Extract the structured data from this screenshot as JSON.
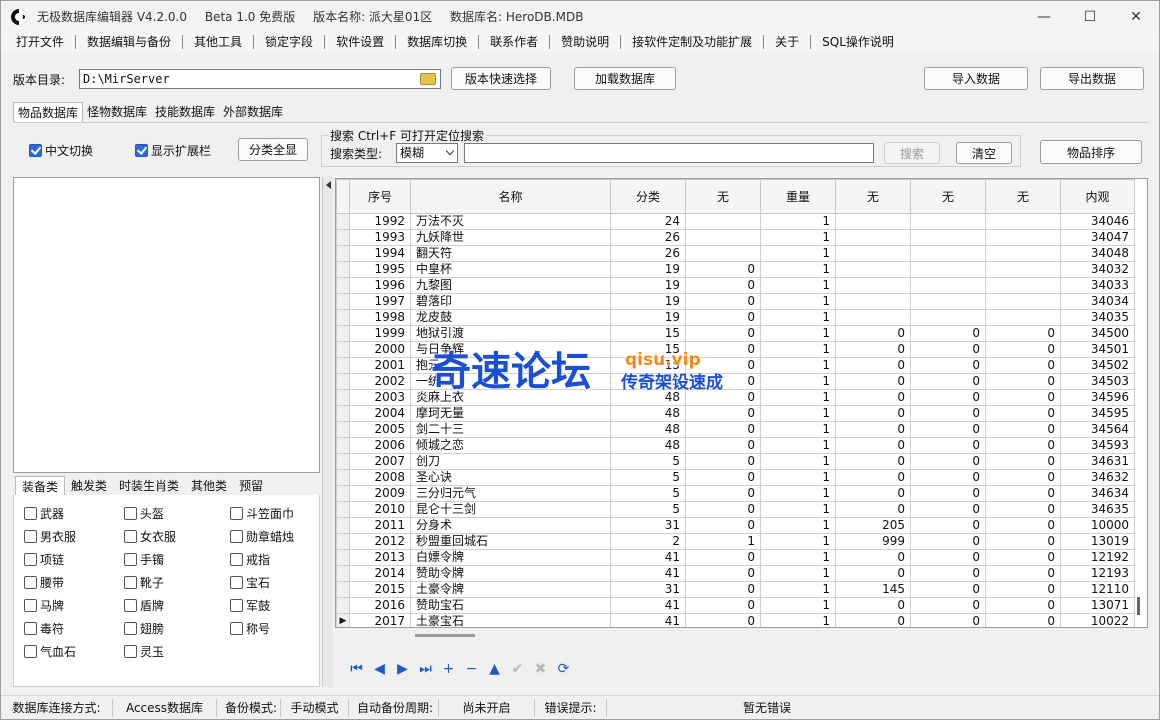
{
  "titlebar": {
    "app_name": "无极数据库编辑器 V4.2.0.0",
    "edition": "Beta 1.0 免费版",
    "version_name": "版本名称: 派大星01区",
    "db_name": "数据库名: HeroDB.MDB",
    "minimize": "—",
    "maximize": "☐",
    "close": "✕"
  },
  "menu": [
    "打开文件",
    "数据编辑与备份",
    "其他工具",
    "锁定字段",
    "软件设置",
    "数据库切换",
    "联系作者",
    "赞助说明",
    "接软件定制及功能扩展",
    "关于",
    "SQL操作说明"
  ],
  "toolbar": {
    "dir_label": "版本目录:",
    "dir_value": "D:\\MirServer",
    "quick_select": "版本快速选择",
    "load_db": "加载数据库",
    "import": "导入数据",
    "export": "导出数据"
  },
  "tabs": [
    "物品数据库",
    "怪物数据库",
    "技能数据库",
    "外部数据库"
  ],
  "options": {
    "chinese_switch": "中文切换",
    "show_ext": "显示扩展栏",
    "expand_all": "分类全显",
    "search_legend": "搜索  Ctrl+F 可打开定位搜索",
    "search_type_label": "搜索类型:",
    "search_type_value": "模糊",
    "search_btn": "搜索",
    "clear_btn": "清空",
    "sort_btn": "物品排序"
  },
  "category_tabs": [
    "装备类",
    "触发类",
    "时装生肖类",
    "其他类",
    "预留"
  ],
  "categories": [
    "武器",
    "头盔",
    "斗笠面巾",
    "男衣服",
    "女衣服",
    "勋章蜡烛",
    "项链",
    "手镯",
    "戒指",
    "腰带",
    "靴子",
    "宝石",
    "马牌",
    "盾牌",
    "军鼓",
    "毒符",
    "翅膀",
    "称号",
    "气血石",
    "灵玉"
  ],
  "grid": {
    "columns": [
      "序号",
      "名称",
      "分类",
      "无",
      "重量",
      "无",
      "无",
      "无",
      "内观"
    ],
    "rows": [
      [
        "1992",
        "万法不灭",
        "24",
        "",
        "1",
        "",
        "",
        "",
        "34046"
      ],
      [
        "1993",
        "九妖降世",
        "26",
        "",
        "1",
        "",
        "",
        "",
        "34047"
      ],
      [
        "1994",
        "翻天符",
        "26",
        "",
        "1",
        "",
        "",
        "",
        "34048"
      ],
      [
        "1995",
        "中皇杯",
        "19",
        "0",
        "1",
        "",
        "",
        "",
        "34032"
      ],
      [
        "1996",
        "九黎图",
        "19",
        "0",
        "1",
        "",
        "",
        "",
        "34033"
      ],
      [
        "1997",
        "碧落印",
        "19",
        "0",
        "1",
        "",
        "",
        "",
        "34034"
      ],
      [
        "1998",
        "龙皮鼓",
        "19",
        "0",
        "1",
        "",
        "",
        "",
        "34035"
      ],
      [
        "1999",
        "地狱引渡",
        "15",
        "0",
        "1",
        "0",
        "0",
        "0",
        "34500"
      ],
      [
        "2000",
        "与日争辉",
        "15",
        "0",
        "1",
        "0",
        "0",
        "0",
        "34501"
      ],
      [
        "2001",
        "抱元",
        "15",
        "0",
        "1",
        "0",
        "0",
        "0",
        "34502"
      ],
      [
        "2002",
        "一统",
        "15",
        "0",
        "1",
        "0",
        "0",
        "0",
        "34503"
      ],
      [
        "2003",
        "炎麻上衣",
        "48",
        "0",
        "1",
        "0",
        "0",
        "0",
        "34596"
      ],
      [
        "2004",
        "摩珂无量",
        "48",
        "0",
        "1",
        "0",
        "0",
        "0",
        "34595"
      ],
      [
        "2005",
        "剑二十三",
        "48",
        "0",
        "1",
        "0",
        "0",
        "0",
        "34564"
      ],
      [
        "2006",
        "倾城之恋",
        "48",
        "0",
        "1",
        "0",
        "0",
        "0",
        "34593"
      ],
      [
        "2007",
        "创刀",
        "5",
        "0",
        "1",
        "0",
        "0",
        "0",
        "34631"
      ],
      [
        "2008",
        "圣心诀",
        "5",
        "0",
        "1",
        "0",
        "0",
        "0",
        "34632"
      ],
      [
        "2009",
        "三分归元气",
        "5",
        "0",
        "1",
        "0",
        "0",
        "0",
        "34634"
      ],
      [
        "2010",
        "昆仑十三剑",
        "5",
        "0",
        "1",
        "0",
        "0",
        "0",
        "34635"
      ],
      [
        "2011",
        "分身术",
        "31",
        "0",
        "1",
        "205",
        "0",
        "0",
        "10000"
      ],
      [
        "2012",
        "秒盟重回城石",
        "2",
        "1",
        "1",
        "999",
        "0",
        "0",
        "13019"
      ],
      [
        "2013",
        "白嫖令牌",
        "41",
        "0",
        "1",
        "0",
        "0",
        "0",
        "12192"
      ],
      [
        "2014",
        "赞助令牌",
        "41",
        "0",
        "1",
        "0",
        "0",
        "0",
        "12193"
      ],
      [
        "2015",
        "土豪令牌",
        "31",
        "0",
        "1",
        "145",
        "0",
        "0",
        "12110"
      ],
      [
        "2016",
        "赞助宝石",
        "41",
        "0",
        "1",
        "0",
        "0",
        "0",
        "13071"
      ],
      [
        "2017",
        "土豪宝石",
        "41",
        "0",
        "1",
        "0",
        "0",
        "0",
        "10022"
      ]
    ]
  },
  "navigator": [
    "⏮",
    "◀",
    "▶",
    "⏭",
    "+",
    "−",
    "▲",
    "✔",
    "✖",
    "⟳"
  ],
  "statusbar": {
    "conn_label": "数据库连接方式:",
    "conn_value": "Access数据库",
    "backup_label": "备份模式:",
    "backup_value": "手动模式",
    "auto_label": "自动备份周期:",
    "auto_value": "尚未开启",
    "err_label": "错误提示:",
    "err_value": "暂无错误"
  },
  "watermark": {
    "main": "奇速论坛",
    "domain": "qisu.vip",
    "sub": "传奇架设速成"
  },
  "colors": {
    "accent": "#2f6bd1",
    "watermark_blue": "#1a4fd6",
    "watermark_orange": "#f08a1c"
  }
}
